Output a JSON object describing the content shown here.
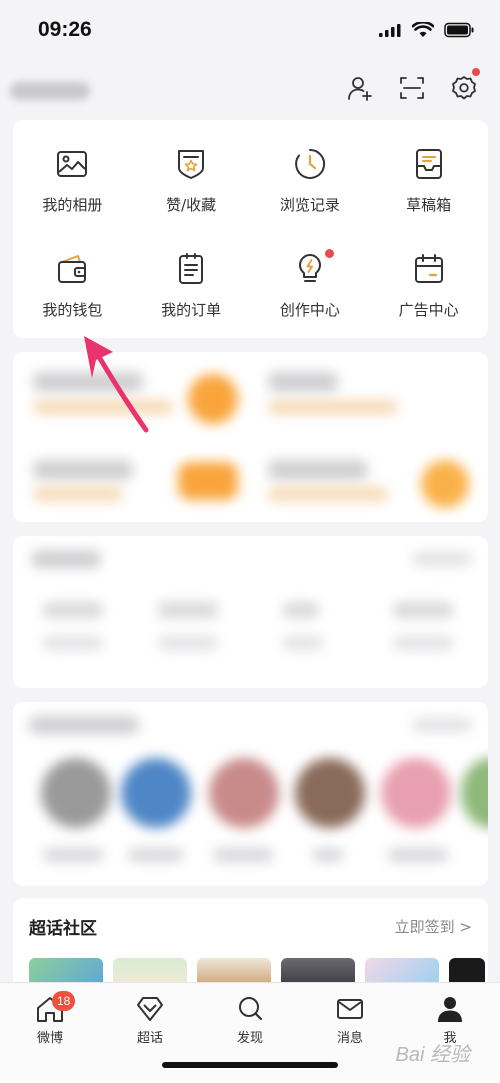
{
  "status": {
    "time": "09:26"
  },
  "grid": {
    "items": [
      {
        "label": "我的相册",
        "icon": "photo-icon"
      },
      {
        "label": "赞/收藏",
        "icon": "favorites-icon"
      },
      {
        "label": "浏览记录",
        "icon": "history-icon"
      },
      {
        "label": "草稿箱",
        "icon": "drafts-icon"
      },
      {
        "label": "我的钱包",
        "icon": "wallet-icon"
      },
      {
        "label": "我的订单",
        "icon": "orders-icon"
      },
      {
        "label": "创作中心",
        "icon": "creator-icon"
      },
      {
        "label": "广告中心",
        "icon": "ad-center-icon"
      }
    ]
  },
  "topic": {
    "title": "超话社区",
    "link": "立即签到 >"
  },
  "tabs": [
    {
      "label": "微博",
      "icon": "home-icon",
      "badge": "18"
    },
    {
      "label": "超话",
      "icon": "diamond-icon"
    },
    {
      "label": "发现",
      "icon": "search-icon"
    },
    {
      "label": "消息",
      "icon": "mail-icon"
    },
    {
      "label": "我",
      "icon": "profile-icon"
    }
  ],
  "watermark": "Bai 经验",
  "colors": {
    "accent": "#e8a23a",
    "badge": "#ef4f3f",
    "arrow": "#e8336d"
  }
}
